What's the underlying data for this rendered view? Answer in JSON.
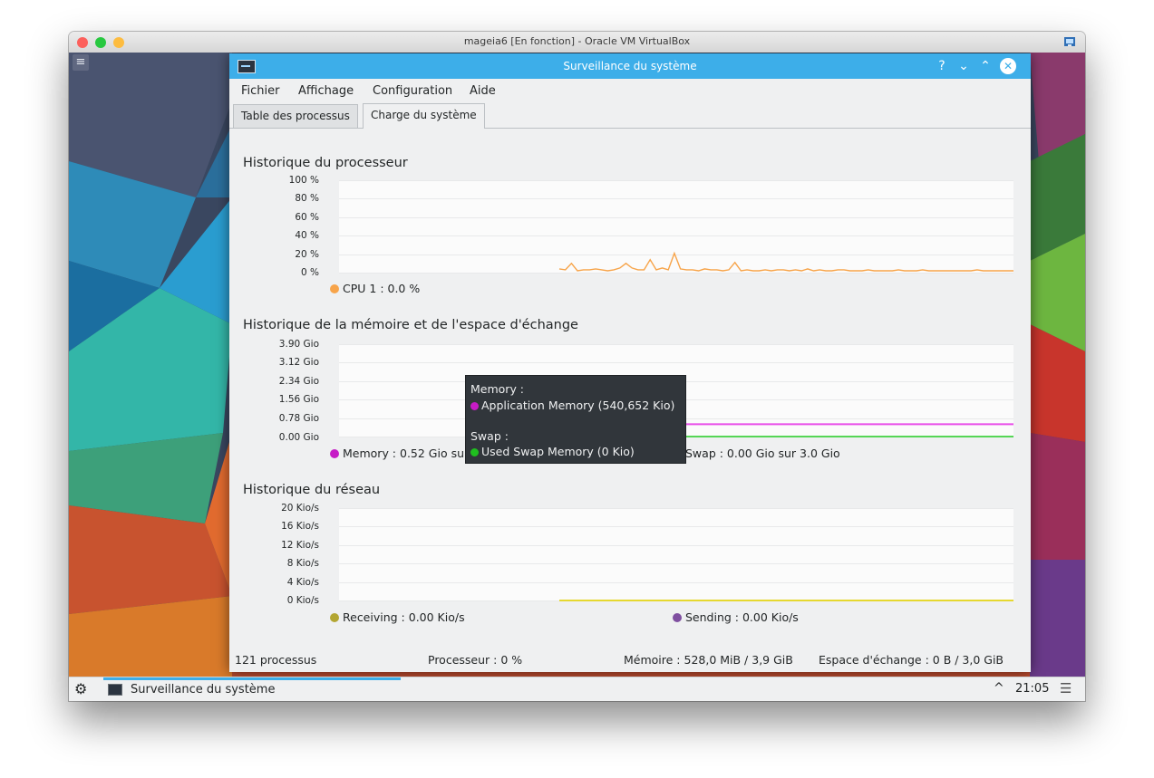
{
  "host": {
    "title": "mageia6 [En fonction] - Oracle VM VirtualBox",
    "lights": [
      "#fc605c",
      "#28c840",
      "#fdbc40"
    ]
  },
  "window": {
    "title": "Surveillance du système",
    "help_glyph": "?",
    "minimize_glyph": "⌄",
    "maximize_glyph": "⌃",
    "close_glyph": "✕",
    "accent": "#3daee9"
  },
  "menu": [
    "Fichier",
    "Affichage",
    "Configuration",
    "Aide"
  ],
  "tabs": [
    {
      "label": "Table des processus",
      "active": false
    },
    {
      "label": "Charge du système",
      "active": true
    }
  ],
  "cpu": {
    "title": "Historique du processeur",
    "ticks": [
      "100 %",
      "80 %",
      "60 %",
      "40 %",
      "20 %",
      "0 %"
    ],
    "legend": "CPU 1 : 0.0 %",
    "color": "#f7a44a"
  },
  "memory": {
    "title": "Historique de la mémoire et de l'espace d'échange",
    "ticks": [
      "3.90 Gio",
      "3.12 Gio",
      "2.34 Gio",
      "1.56 Gio",
      "0.78 Gio",
      "0.00 Gio"
    ],
    "legend_memory": "Memory : 0.52 Gio sur",
    "legend_swap": "Swap : 0.00 Gio sur 3.0 Gio",
    "memory_color": "#c61bc6",
    "swap_color": "#1fbf1f"
  },
  "tooltip": {
    "memory_header": "Memory :",
    "memory_item": "Application Memory (540,652 Kio)",
    "swap_header": "Swap :",
    "swap_item": "Used Swap Memory (0 Kio)"
  },
  "network": {
    "title": "Historique du réseau",
    "ticks": [
      "20 Kio/s",
      "16 Kio/s",
      "12 Kio/s",
      "8 Kio/s",
      "4 Kio/s",
      "0 Kio/s"
    ],
    "legend_receiving": "Receiving : 0.00 Kio/s",
    "legend_sending": "Sending : 0.00 Kio/s",
    "receiving_color": "#b3a632",
    "sending_color": "#7f4fa0"
  },
  "status": {
    "processes": "121 processus",
    "cpu": "Processeur : 0 %",
    "memory": "Mémoire : 528,0 MiB / 3,9 GiB",
    "swap": "Espace d'échange : 0 B / 3,0 GiB"
  },
  "taskbar": {
    "task_label": "Surveillance du système",
    "clock": "21:05",
    "tray_up_glyph": "^",
    "menu_glyph": "☰",
    "kicker_glyph": "⚙"
  },
  "chart_data": [
    {
      "type": "line",
      "title": "Historique du processeur",
      "ylim": [
        0,
        100
      ],
      "yunit": "%",
      "series": [
        {
          "name": "CPU 1",
          "values": [
            4,
            3,
            10,
            2,
            3,
            3,
            4,
            3,
            2,
            3,
            5,
            10,
            5,
            3,
            3,
            14,
            3,
            5,
            3,
            21,
            4,
            3,
            3,
            2,
            4,
            3,
            3,
            2,
            3,
            11,
            2,
            3,
            2,
            2,
            3,
            2,
            3,
            3,
            2,
            3,
            2,
            4,
            2,
            3,
            2,
            2,
            3,
            3,
            2,
            2,
            2,
            3,
            2,
            2,
            2,
            2,
            3,
            2,
            2,
            2,
            3,
            2,
            2,
            2,
            2,
            2,
            2,
            2,
            2,
            3,
            2,
            2,
            2,
            2,
            2,
            2
          ]
        }
      ]
    },
    {
      "type": "line",
      "title": "Historique de la mémoire et de l'espace d'échange",
      "ylim": [
        0,
        3.9
      ],
      "yunit": "Gio",
      "series": [
        {
          "name": "Memory",
          "values": [
            0.52,
            0.52,
            0.52,
            0.52,
            0.52,
            0.52,
            0.52,
            0.52,
            0.52,
            0.52
          ]
        },
        {
          "name": "Swap",
          "values": [
            0,
            0,
            0,
            0,
            0,
            0,
            0,
            0,
            0,
            0
          ]
        }
      ]
    },
    {
      "type": "line",
      "title": "Historique du réseau",
      "ylim": [
        0,
        20
      ],
      "yunit": "Kio/s",
      "series": [
        {
          "name": "Receiving",
          "values": [
            0,
            0,
            0,
            0,
            0,
            0,
            0,
            0,
            0,
            0
          ]
        },
        {
          "name": "Sending",
          "values": [
            0,
            0,
            0,
            0,
            0,
            0,
            0,
            0,
            0,
            0
          ]
        }
      ]
    }
  ]
}
